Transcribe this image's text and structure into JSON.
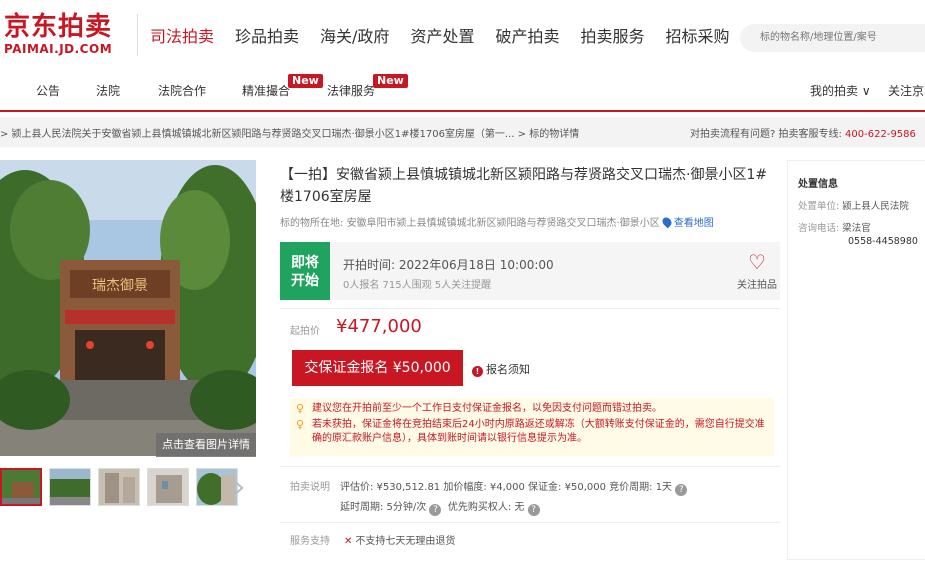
{
  "header": {
    "logo_cn": "京东拍卖",
    "logo_en": "PAIMAI.JD.COM",
    "nav": [
      "司法拍卖",
      "珍品拍卖",
      "海关/政府",
      "资产处置",
      "破产拍卖",
      "拍卖服务",
      "招标采购"
    ],
    "search_placeholder": "标的物名称/地理位置/案号"
  },
  "sub_nav": {
    "items": [
      "公告",
      "法院",
      "法院合作",
      "精准撮合",
      "法律服务"
    ],
    "badge": "New",
    "my_auction": "我的拍卖 ∨",
    "follow": "关注京东"
  },
  "breadcrumb": {
    "text": "> 颍上县人民法院关于安徽省颍上县慎城镇城北新区颍阳路与荐贤路交叉口瑞杰·御景小区1#楼1706室房屋（第一...  > 标的物详情",
    "help": "对拍卖流程有问题? 拍卖客服专线: ",
    "phone": "400-622-9586"
  },
  "gallery": {
    "detail_button": "点击查看图片详情",
    "arrow": "›"
  },
  "item": {
    "title": "【一拍】安徽省颍上县慎城镇城北新区颍阳路与荐贤路交叉口瑞杰·御景小区1#楼1706室房屋",
    "location_label": "标的物所在地: ",
    "location": "安徽阜阳市颍上县慎城镇城北新区颍阳路与荐贤路交叉口瑞杰·御景小区",
    "map_link": "查看地图",
    "status_line1": "即将",
    "status_line2": "开始",
    "start_time": "开拍时间: 2022年06月18日 10:00:00",
    "stats": "0人报名   715人围观   5人关注提醒",
    "follow_label": "关注拍品",
    "price_label": "起拍价",
    "price": "¥477,000",
    "deposit_button": "交保证金报名 ¥50,000",
    "notice": "报名须知",
    "tips": [
      "建议您在开拍前至少一个工作日支付保证金报名，以免因支付问题而错过拍卖。",
      "若未获拍，保证金将在竞拍结束后24小时内原路返还或解冻（大额转账支付保证金的，需您自行提交准确的原汇款账户信息），具体到账时间请以银行信息提示为准。"
    ],
    "auction_info_label": "拍卖说明",
    "auction_info_row1": "评估价: ¥530,512.81   加价幅度: ¥4,000   保证金: ¥50,000   竞价周期: 1天",
    "auction_info_row2": "延时周期: 5分钟/次",
    "auction_info_row2b": "优先购买权人: 无",
    "support_label": "服务支持",
    "support_text": "不支持七天无理由退货"
  },
  "disposal": {
    "title": "处置信息",
    "unit_label": "处置单位:",
    "unit": "颍上县人民法院",
    "contact_label": "咨询电话:",
    "contact_name": "梁法官",
    "contact_phone": "0558-4458980"
  },
  "colors": {
    "brand_red": "#c81623",
    "status_green": "#1fa35f",
    "link_blue": "#2a6ccf"
  }
}
